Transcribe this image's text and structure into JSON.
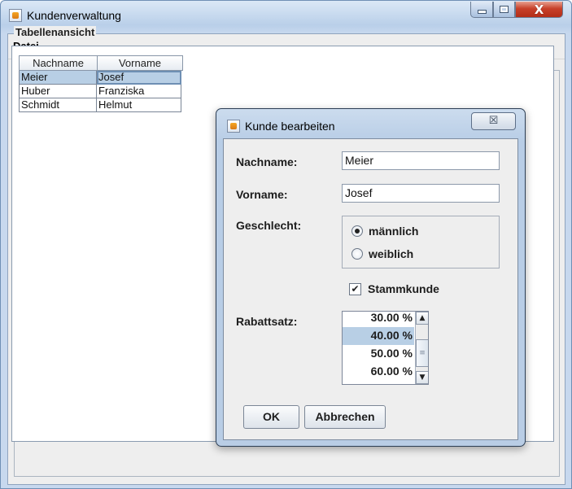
{
  "window": {
    "title": "Kundenverwaltung",
    "icon": "java-app-icon",
    "controls": {
      "minimize": "minimize-icon",
      "maximize": "maximize-icon",
      "close_glyph": "X"
    }
  },
  "menu": {
    "items": [
      "Datei"
    ]
  },
  "main": {
    "fieldset_title": "Tabellenansicht",
    "table": {
      "headers": [
        "Nachname",
        "Vorname"
      ],
      "rows": [
        [
          "Meier",
          "Josef"
        ],
        [
          "Huber",
          "Franziska"
        ],
        [
          "Schmidt",
          "Helmut"
        ]
      ],
      "selected_row": 0
    }
  },
  "dialog": {
    "title": "Kunde bearbeiten",
    "close_glyph": "☒",
    "labels": {
      "nachname": "Nachname:",
      "vorname": "Vorname:",
      "geschlecht": "Geschlecht:",
      "rabattsatz": "Rabattsatz:"
    },
    "fields": {
      "nachname": "Meier",
      "vorname": "Josef"
    },
    "gender_options": [
      "männlich",
      "weiblich"
    ],
    "gender_selected": "männlich",
    "stammkunde_label": "Stammkunde",
    "stammkunde_checked": true,
    "check_glyph": "✔",
    "rabatt_options": [
      "30.00 %",
      "40.00 %",
      "50.00 %",
      "60.00 %"
    ],
    "rabatt_selected": "40.00 %",
    "buttons": {
      "ok": "OK",
      "cancel": "Abbrechen"
    }
  }
}
